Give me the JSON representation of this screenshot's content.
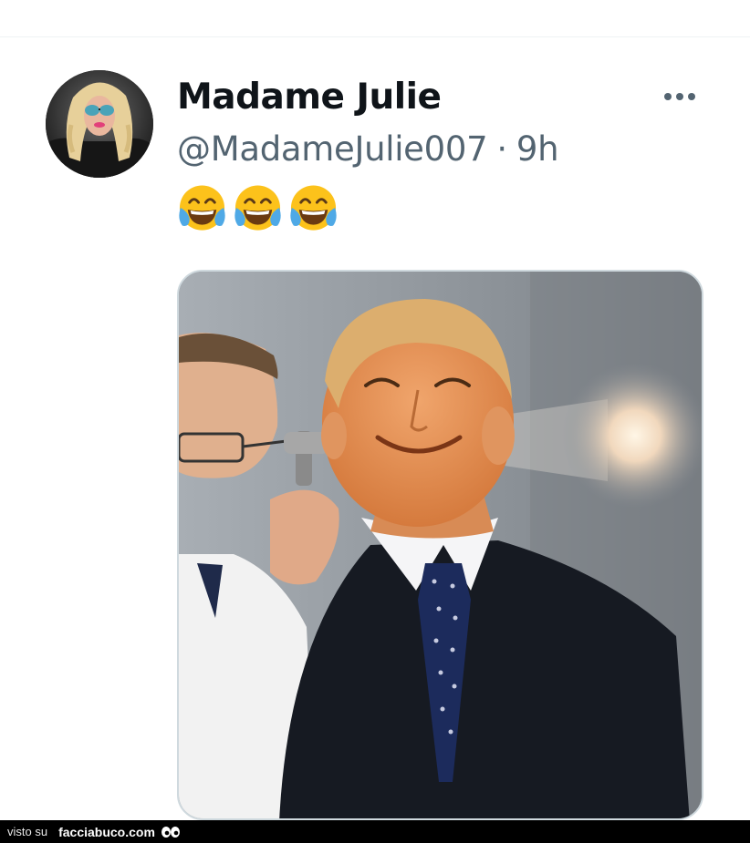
{
  "tweet": {
    "author": {
      "display_name": "Madame Julie",
      "handle": "@MadameJulie007",
      "avatar_icon": "profile-photo-avatar"
    },
    "separator": "·",
    "time": "9h",
    "text_emojis": [
      "face-with-tears-of-joy",
      "face-with-tears-of-joy",
      "face-with-tears-of-joy"
    ],
    "more_icon": "more-horizontal-icon",
    "media": {
      "kind": "photo",
      "alt": ""
    }
  },
  "footer": {
    "prefix": "visto su",
    "brand": "facciabuco.com",
    "logo_icon": "eyes-icon"
  },
  "colors": {
    "text_primary": "#0f1419",
    "text_secondary": "#536471",
    "border": "#cfd9de",
    "footer_bg": "#000000"
  }
}
